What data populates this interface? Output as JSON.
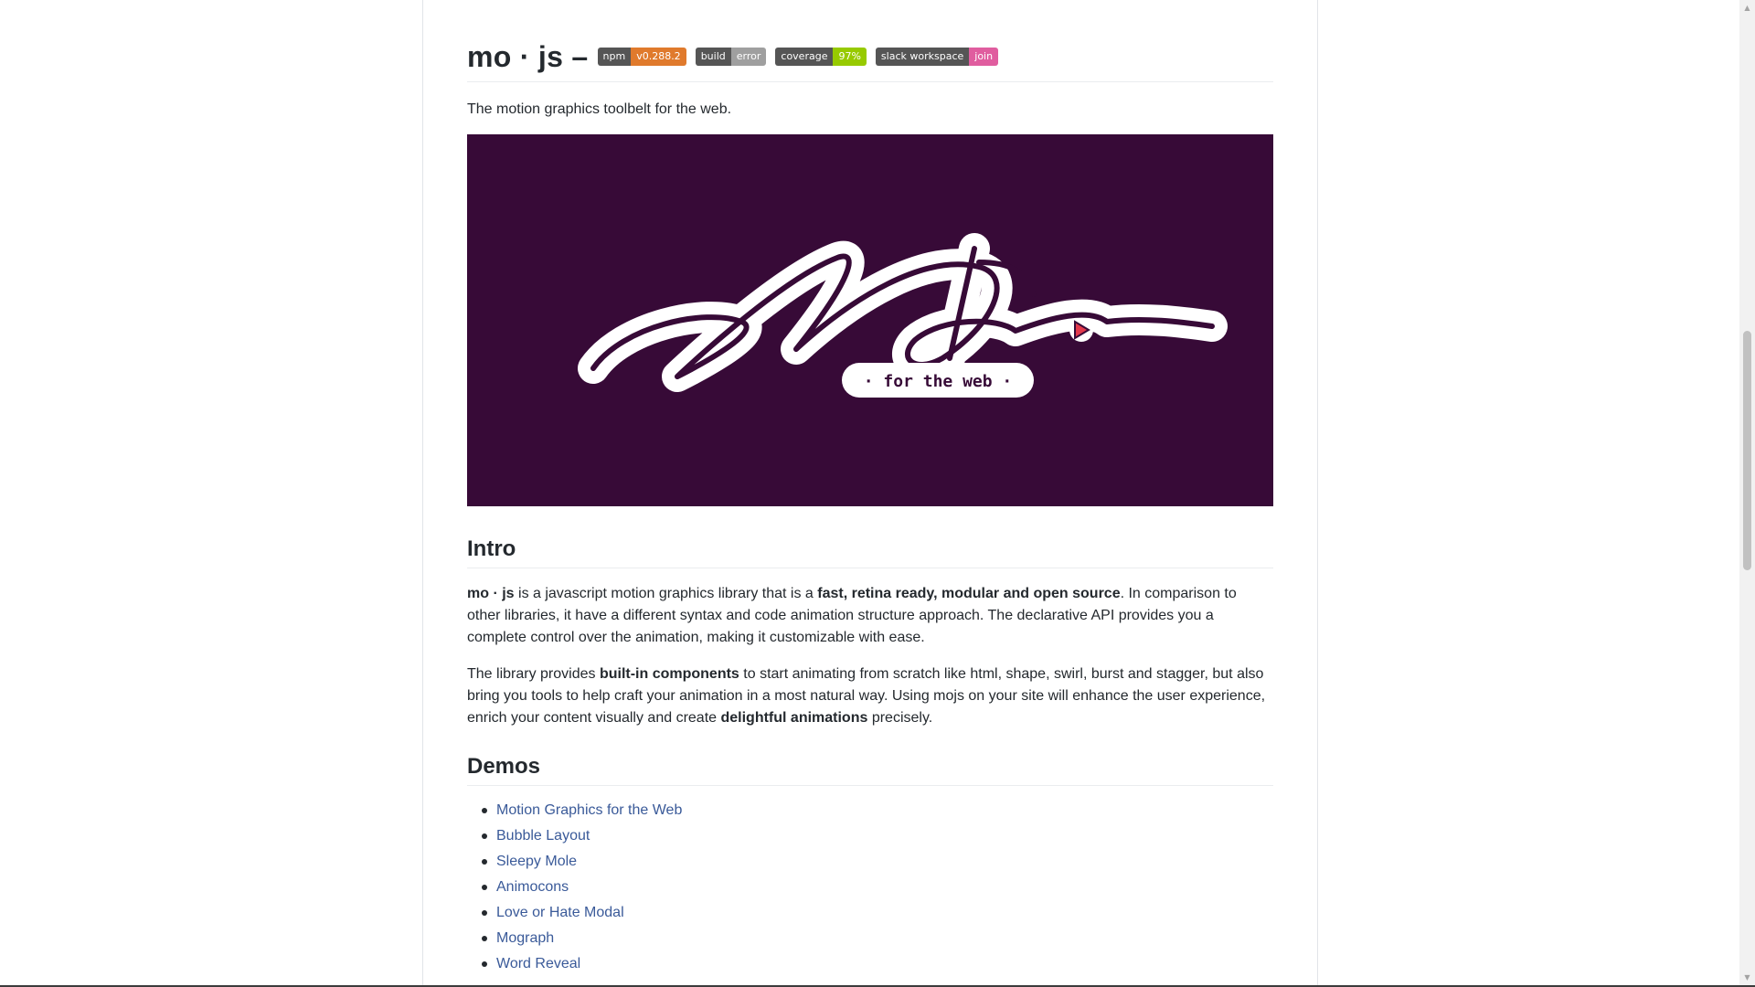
{
  "header": {
    "title": "mo · js –",
    "badges": [
      {
        "label": "npm",
        "value": "v0.288.2",
        "color": "#e07a2c"
      },
      {
        "label": "build",
        "value": "error",
        "color": "#9f9f9f"
      },
      {
        "label": "coverage",
        "value": "97%",
        "color": "#97ca00"
      },
      {
        "label": "slack workspace",
        "value": "join",
        "color": "#e05d9f"
      }
    ]
  },
  "tagline": "The motion graphics toolbelt for the web.",
  "hero": {
    "script_text": "Motion",
    "subtitle": "· for the web ·",
    "background": "#370a37"
  },
  "intro": {
    "heading": "Intro",
    "p1": {
      "s1": "mo · js",
      "s2": " is a javascript motion graphics library that is a ",
      "s3": "fast, retina ready, modular and open source",
      "s4": ". In comparison to other libraries, it have a different syntax and code animation structure approach. The declarative API provides you a complete control over the animation, making it customizable with ease."
    },
    "p2": {
      "s1": "The library provides ",
      "s2": "built-in components",
      "s3": " to start animating from scratch like html, shape, swirl, burst and stagger, but also bring you tools to help craft your animation in a most natural way. Using mojs on your site will enhance the user experience, enrich your content visually and create ",
      "s4": "delightful animations",
      "s5": " precisely."
    }
  },
  "demos": {
    "heading": "Demos",
    "items": [
      "Motion Graphics for the Web",
      "Bubble Layout",
      "Sleepy Mole",
      "Animocons",
      "Love or Hate Modal",
      "Mograph",
      "Word Reveal"
    ]
  },
  "colors": {
    "link": "#3a5a99",
    "text": "#24292e"
  }
}
